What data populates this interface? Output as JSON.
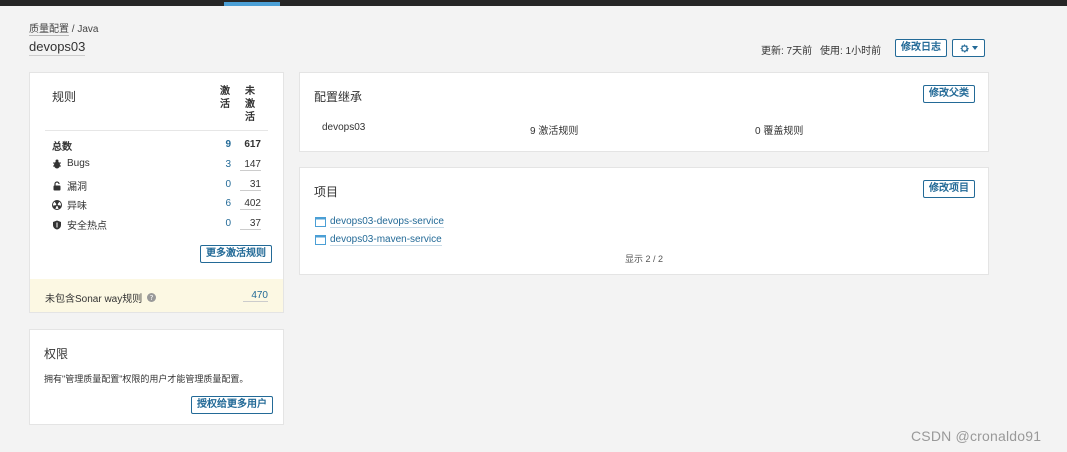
{
  "nav": {
    "active_indicator_color": "#4b9fd5"
  },
  "breadcrumb": {
    "link": "质量配置",
    "separator": "/",
    "current": "Java"
  },
  "profile": {
    "name": "devops03"
  },
  "header": {
    "updated": "更新: 7天前",
    "used": "使用: 1小时前",
    "edit_log_label": "修改日志",
    "gear_icon": "gear-icon"
  },
  "rules": {
    "title": "规则",
    "col_active": "激活",
    "col_inactive": "未激活",
    "rows": [
      {
        "label": "总数",
        "active": "9",
        "inactive": "617",
        "icon": ""
      },
      {
        "label": "Bugs",
        "active": "3",
        "inactive": "147",
        "icon": "bug-icon"
      },
      {
        "label": "漏洞",
        "active": "0",
        "inactive": "31",
        "icon": "lock-icon"
      },
      {
        "label": "异味",
        "active": "6",
        "inactive": "402",
        "icon": "radiation-icon"
      },
      {
        "label": "安全热点",
        "active": "0",
        "inactive": "37",
        "icon": "shield-icon"
      }
    ],
    "more_button": "更多激活规则",
    "sonar_way_label": "未包含Sonar way规则",
    "sonar_way_count": "470"
  },
  "permissions": {
    "title": "权限",
    "description": "拥有\"管理质量配置\"权限的用户才能管理质量配置。",
    "grant_button": "授权给更多用户"
  },
  "inheritance": {
    "title": "配置继承",
    "edit_parent_button": "修改父类",
    "profile": "devops03",
    "active_rules": "9 激活规则",
    "override_rules": "0 覆盖规则"
  },
  "projects": {
    "title": "项目",
    "edit_button": "修改项目",
    "items": [
      "devops03-devops-service",
      "devops03-maven-service"
    ],
    "showing": "显示 2 / 2"
  },
  "watermark": "CSDN @cronaldo91",
  "colors": {
    "accent": "#236a97",
    "highlight_bg": "#fcf8e3"
  }
}
